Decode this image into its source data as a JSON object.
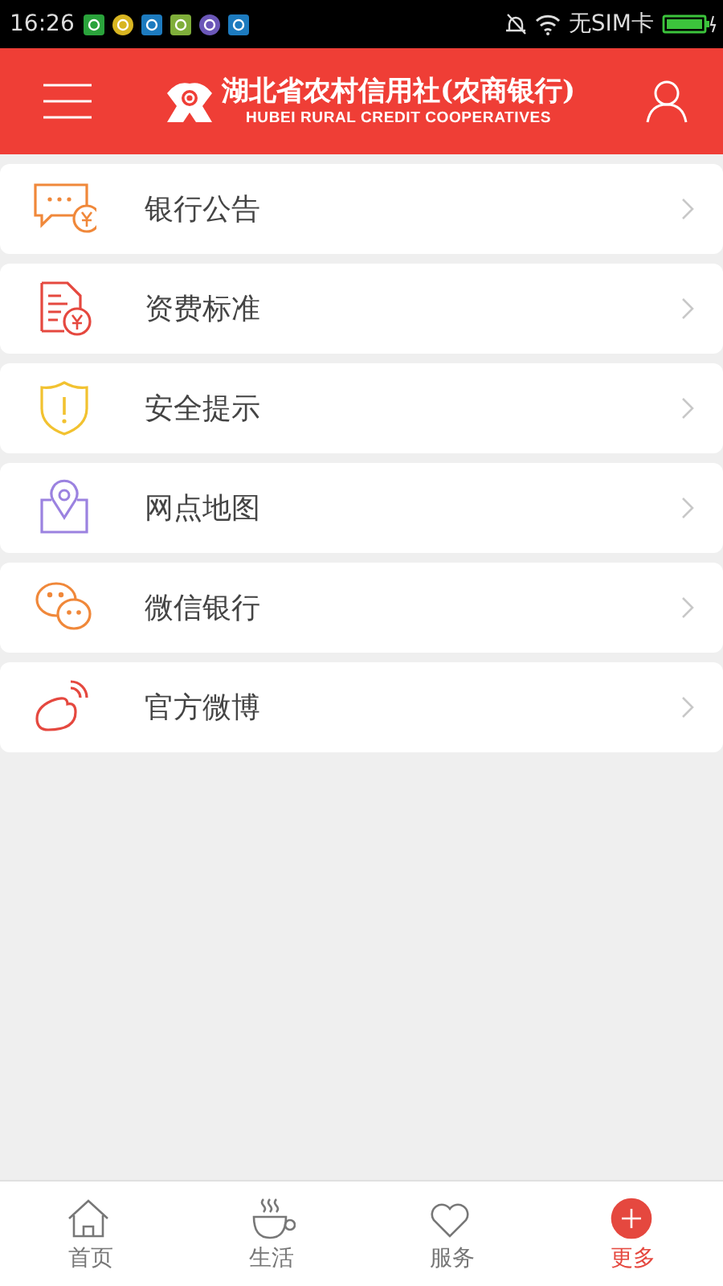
{
  "status_bar": {
    "time": "16:26",
    "carrier": "无SIM卡"
  },
  "header": {
    "title": "湖北省农村信用社(农商银行)",
    "subtitle": "HUBEI RURAL CREDIT COOPERATIVES"
  },
  "menu": [
    {
      "kind": "notice",
      "label": "银行公告",
      "color": "#f0883a"
    },
    {
      "kind": "fee",
      "label": "资费标准",
      "color": "#e5483f"
    },
    {
      "kind": "safety",
      "label": "安全提示",
      "color": "#f2c230"
    },
    {
      "kind": "map",
      "label": "网点地图",
      "color": "#9b82e0"
    },
    {
      "kind": "wechat",
      "label": "微信银行",
      "color": "#f0883a"
    },
    {
      "kind": "weibo",
      "label": "官方微博",
      "color": "#e5483f"
    }
  ],
  "tabs": [
    {
      "kind": "home",
      "label": "首页",
      "selected": false
    },
    {
      "kind": "life",
      "label": "生活",
      "selected": false
    },
    {
      "kind": "service",
      "label": "服务",
      "selected": false
    },
    {
      "kind": "more",
      "label": "更多",
      "selected": true
    }
  ]
}
